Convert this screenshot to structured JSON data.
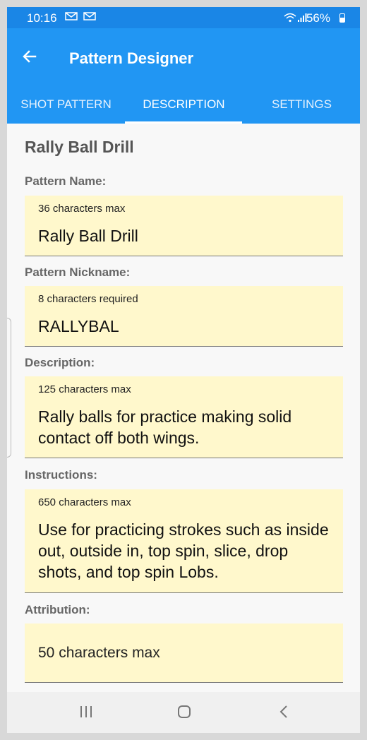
{
  "status_bar": {
    "time": "10:16",
    "battery": "56%",
    "left_icons": [
      "mail-icon",
      "mail-icon"
    ],
    "right_icons": [
      "wifi-icon",
      "signal-icon"
    ]
  },
  "app_bar": {
    "title": "Pattern Designer",
    "back_icon": "arrow-left-icon"
  },
  "tabs": [
    {
      "label": "SHOT PATTERN",
      "selected": false
    },
    {
      "label": "DESCRIPTION",
      "selected": true
    },
    {
      "label": "SETTINGS",
      "selected": false
    }
  ],
  "page_title": "Rally Ball Drill",
  "fields": {
    "name": {
      "label": "Pattern Name:",
      "hint": "36 characters max",
      "value": "Rally Ball Drill"
    },
    "nickname": {
      "label": "Pattern Nickname:",
      "hint": "8 characters required",
      "value": "RALLYBAL"
    },
    "description": {
      "label": "Description:",
      "hint": "125 characters max",
      "value": "Rally balls for practice making solid contact off both wings."
    },
    "instructions": {
      "label": "Instructions:",
      "hint": "650 characters max",
      "value": "Use for practicing strokes such as inside out, outside in, top spin, slice, drop shots, and top spin Lobs."
    },
    "attribution": {
      "label": "Attribution:",
      "placeholder": "50 characters max",
      "value": ""
    }
  },
  "nav_bar": {
    "recent_icon": "recent-apps-icon",
    "home_icon": "home-icon",
    "back_icon": "back-icon"
  },
  "colors": {
    "status_bar": "#1a86e6",
    "app_bar": "#2196f3",
    "field_bg": "#fff8cc",
    "label": "#666666"
  }
}
